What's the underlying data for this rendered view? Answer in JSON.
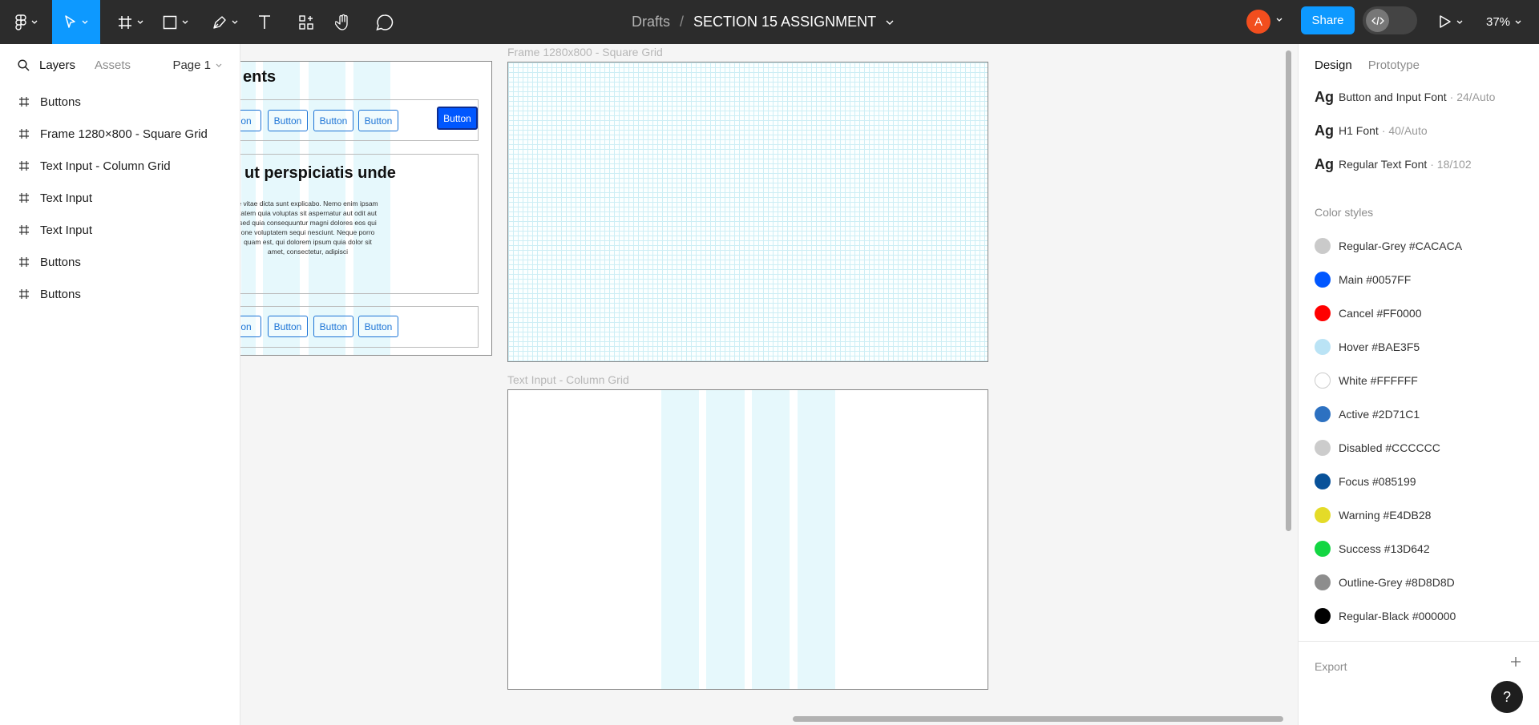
{
  "toolbar": {
    "breadcrumb_parent": "Drafts",
    "breadcrumb_sep": "/",
    "file_title": "SECTION 15 ASSIGNMENT",
    "avatar_initial": "A",
    "share_label": "Share",
    "zoom": "37%",
    "active_tool": "move"
  },
  "left_panel": {
    "tab_layers": "Layers",
    "tab_assets": "Assets",
    "page_selector": "Page 1",
    "layers": [
      "Buttons",
      "Frame 1280×800 - Square Grid",
      "Text Input - Column Grid",
      "Text Input",
      "Text Input",
      "Buttons",
      "Buttons"
    ]
  },
  "canvas": {
    "frame_square_label": "Frame 1280x800 - Square Grid",
    "frame_column_label": "Text Input - Column Grid",
    "left_frame": {
      "heading_partial": "ents",
      "heading2": "ut perspiciatis unde",
      "paragraph": "e vitae dicta sunt explicabo. Nemo enim ipsam tatem quia voluptas sit aspernatur aut odit aut sed quia consequuntur magni dolores eos qui one voluptatem sequi nesciunt. Neque porro quam est, qui dolorem ipsum quia dolor sit amet, consectetur, adipisci",
      "button_partial": "on",
      "button_label": "Button"
    }
  },
  "right_panel": {
    "tab_design": "Design",
    "tab_prototype": "Prototype",
    "text_styles": [
      {
        "ag": "Ag",
        "name": "Button and Input Font",
        "meta": "· 24/Auto"
      },
      {
        "ag": "Ag",
        "name": "H1 Font",
        "meta": "· 40/Auto"
      },
      {
        "ag": "Ag",
        "name": "Regular Text Font",
        "meta": "· 18/102"
      }
    ],
    "color_styles_title": "Color styles",
    "color_styles": [
      {
        "label": "Regular-Grey #CACACA",
        "hex": "#CACACA"
      },
      {
        "label": "Main #0057FF",
        "hex": "#0057FF"
      },
      {
        "label": "Cancel #FF0000",
        "hex": "#FF0000"
      },
      {
        "label": "Hover #BAE3F5",
        "hex": "#BAE3F5"
      },
      {
        "label": "White #FFFFFF",
        "hex": "#FFFFFF"
      },
      {
        "label": "Active #2D71C1",
        "hex": "#2D71C1"
      },
      {
        "label": "Disabled #CCCCCC",
        "hex": "#CCCCCC"
      },
      {
        "label": "Focus #085199",
        "hex": "#085199"
      },
      {
        "label": "Warning #E4DB28",
        "hex": "#E4DB28"
      },
      {
        "label": "Success #13D642",
        "hex": "#13D642"
      },
      {
        "label": "Outline-Grey #8D8D8D",
        "hex": "#8D8D8D"
      },
      {
        "label": "Regular-Black #000000",
        "hex": "#000000"
      }
    ],
    "export_label": "Export",
    "help_label": "?"
  }
}
